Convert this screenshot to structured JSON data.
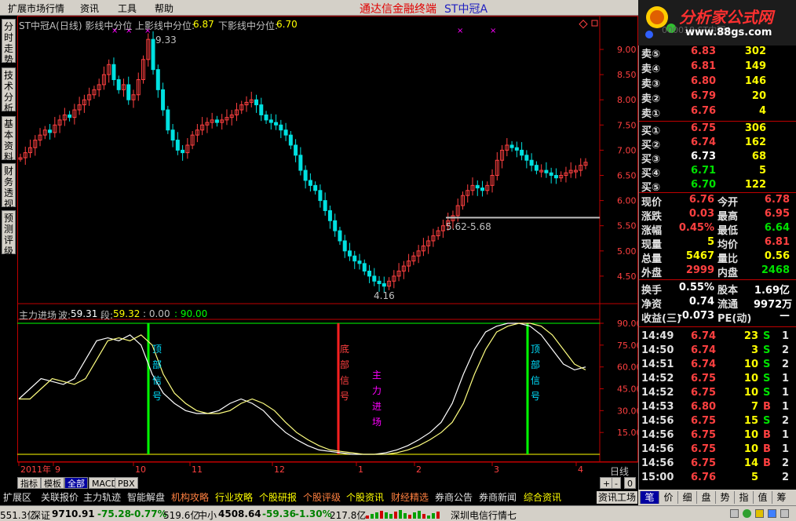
{
  "menu": {
    "items": [
      "扩展市场行情",
      "资讯",
      "工具",
      "帮助"
    ],
    "app_title": "通达信金融终端",
    "stock_title": "ST中冠A"
  },
  "logo": {
    "text": "分析家公式网",
    "url_text": "www.88gs.com",
    "ghost": "000018 ST中冠A"
  },
  "side_tabs": [
    "分时走势",
    "技术分析",
    "基本资料",
    "财务透视",
    "预测评级"
  ],
  "main_chart": {
    "header": "ST中冠A(日线) 影线中分位",
    "upper_label": "上影线中分位:",
    "upper_value": "6.87",
    "lower_label": "下影线中分位:",
    "lower_value": "6.70",
    "high_annotation": "9.33",
    "low_annotation": "4.16",
    "range_annotation": "5.62-5.68",
    "colors": {
      "up": "#ff4040",
      "down": "#00e0e0",
      "axis": "#c00000",
      "label": "#ff4040"
    }
  },
  "indicator": {
    "header_name": "主力进场",
    "wave_label": "波:",
    "wave_value": "59.31",
    "seg_label": "段:",
    "seg_value": "59.32",
    "zero_value": ": 0.00",
    "ninety_value": ": 90.00",
    "signals": [
      {
        "text": "顶部信号",
        "color": "#00e0ff"
      },
      {
        "text": "底部信号",
        "color": "#ff4040"
      },
      {
        "text": "主力进场",
        "color": "#ff00ff"
      },
      {
        "text": "顶部信号",
        "color": "#00e0ff"
      }
    ]
  },
  "x_axis": {
    "labels": [
      "2011年",
      "9",
      "10",
      "11",
      "12",
      "1",
      "2",
      "3",
      "4"
    ],
    "period": "日线"
  },
  "bottom_tabs": [
    "指标",
    "模板",
    "全部",
    "MACD",
    "PBX"
  ],
  "zoom_buttons": [
    "+",
    "-",
    "0"
  ],
  "nav_tabs": [
    "扩展区",
    "关联报价",
    "主力轨迹",
    "智能解盘",
    "机构攻略",
    "行业攻略",
    "个股研报",
    "个股评级",
    "个股资讯",
    "财经精选",
    "券商公告",
    "券商新闻",
    "综合资讯"
  ],
  "nav_tab_right": "资讯工场",
  "order_book": {
    "asks": [
      {
        "label": "卖⑤",
        "price": "6.83",
        "vol": "302"
      },
      {
        "label": "卖④",
        "price": "6.81",
        "vol": "149"
      },
      {
        "label": "卖③",
        "price": "6.80",
        "vol": "146"
      },
      {
        "label": "卖②",
        "price": "6.79",
        "vol": "20"
      },
      {
        "label": "卖①",
        "price": "6.76",
        "vol": "4"
      }
    ],
    "bids": [
      {
        "label": "买①",
        "price": "6.75",
        "vol": "306"
      },
      {
        "label": "买②",
        "price": "6.74",
        "vol": "162"
      },
      {
        "label": "买③",
        "price": "6.73",
        "vol": "68"
      },
      {
        "label": "买④",
        "price": "6.71",
        "vol": "5"
      },
      {
        "label": "买⑤",
        "price": "6.70",
        "vol": "122"
      }
    ]
  },
  "quote": [
    {
      "l1": "现价",
      "v1": "6.76",
      "l2": "今开",
      "v2": "6.78"
    },
    {
      "l1": "涨跌",
      "v1": "0.03",
      "l2": "最高",
      "v2": "6.95"
    },
    {
      "l1": "涨幅",
      "v1": "0.45%",
      "l2": "最低",
      "v2": "6.64"
    },
    {
      "l1": "现量",
      "v1": "5",
      "l2": "均价",
      "v2": "6.81"
    },
    {
      "l1": "总量",
      "v1": "5467",
      "l2": "量比",
      "v2": "0.56"
    },
    {
      "l1": "外盘",
      "v1": "2999",
      "l2": "内盘",
      "v2": "2468"
    }
  ],
  "fundamentals": [
    {
      "l1": "换手",
      "v1": "0.55%",
      "l2": "股本",
      "v2": "1.69亿"
    },
    {
      "l1": "净资",
      "v1": "0.74",
      "l2": "流通",
      "v2": "9972万"
    },
    {
      "l1": "收益(三)",
      "v1": "-0.073",
      "l2": "PE(动)",
      "v2": "—"
    }
  ],
  "ticks": [
    {
      "time": "14:49",
      "price": "6.74",
      "vol": "23",
      "bs": "S",
      "n": "1"
    },
    {
      "time": "14:50",
      "price": "6.74",
      "vol": "3",
      "bs": "S",
      "n": "2"
    },
    {
      "time": "14:51",
      "price": "6.74",
      "vol": "10",
      "bs": "S",
      "n": "2"
    },
    {
      "time": "14:52",
      "price": "6.75",
      "vol": "10",
      "bs": "S",
      "n": "1"
    },
    {
      "time": "14:52",
      "price": "6.75",
      "vol": "10",
      "bs": "S",
      "n": "1"
    },
    {
      "time": "14:53",
      "price": "6.80",
      "vol": "7",
      "bs": "B",
      "n": "1"
    },
    {
      "time": "14:56",
      "price": "6.75",
      "vol": "15",
      "bs": "S",
      "n": "2"
    },
    {
      "time": "14:56",
      "price": "6.75",
      "vol": "10",
      "bs": "B",
      "n": "1"
    },
    {
      "time": "14:56",
      "price": "6.75",
      "vol": "10",
      "bs": "B",
      "n": "1"
    },
    {
      "time": "14:56",
      "price": "6.75",
      "vol": "14",
      "bs": "B",
      "n": "2"
    },
    {
      "time": "15:00",
      "price": "6.76",
      "vol": "5",
      "bs": "",
      "n": "2"
    }
  ],
  "right_tabs": [
    "笔",
    "价",
    "细",
    "盘",
    "势",
    "指",
    "值",
    "筹"
  ],
  "status": {
    "left_cut": "551.3亿",
    "sz_label": "深证",
    "sz_value": "9710.91",
    "sz_change": "-75.28",
    "sz_pct": "-0.77%",
    "sz_amount": "519.6亿",
    "zx_label": "中小",
    "zx_value": "4508.64",
    "zx_change": "-59.36",
    "zx_pct": "-1.30%",
    "zx_amount": "217.8亿",
    "server": "深圳电信行情七"
  }
}
